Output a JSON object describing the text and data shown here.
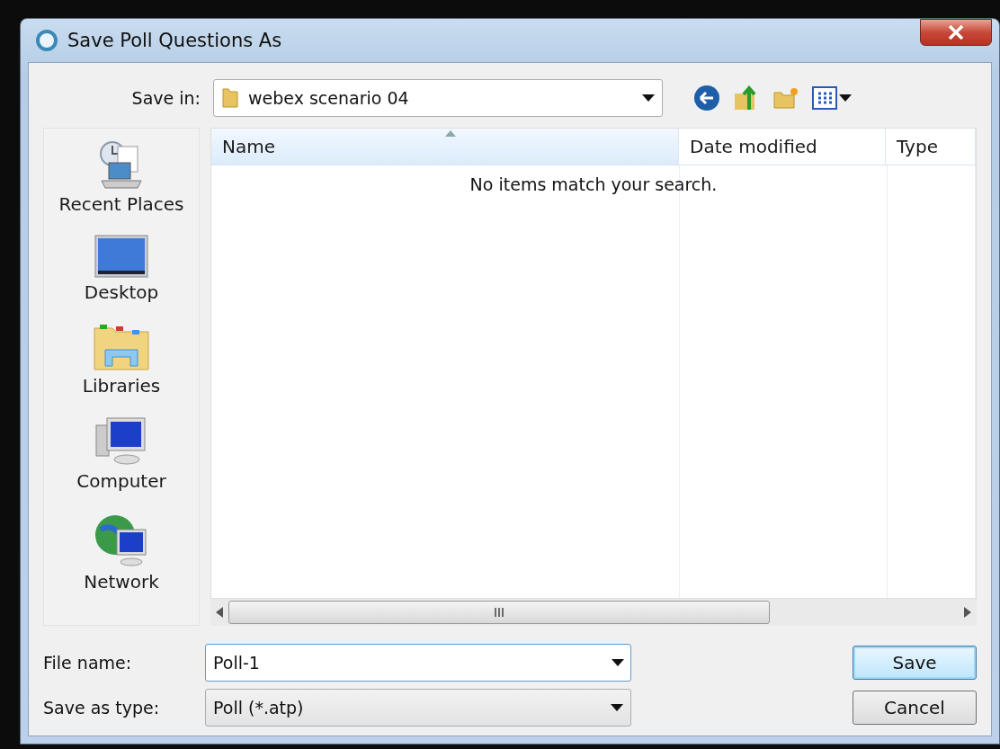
{
  "window": {
    "title": "Save Poll Questions As"
  },
  "toolbar": {
    "save_in_label": "Save in:",
    "location": "webex scenario 04"
  },
  "sidebar": {
    "items": [
      {
        "label": "Recent Places",
        "kind": "recent"
      },
      {
        "label": "Desktop",
        "kind": "desktop"
      },
      {
        "label": "Libraries",
        "kind": "libraries"
      },
      {
        "label": "Computer",
        "kind": "computer"
      },
      {
        "label": "Network",
        "kind": "network"
      }
    ]
  },
  "file_list": {
    "columns": [
      {
        "label": "Name",
        "sorted": true
      },
      {
        "label": "Date modified",
        "sorted": false
      },
      {
        "label": "Type",
        "sorted": false
      }
    ],
    "empty_message": "No items match your search."
  },
  "form": {
    "file_name_label": "File name:",
    "file_name": "Poll-1",
    "type_label": "Save as type:",
    "type": "Poll (*.atp)"
  },
  "buttons": [
    {
      "label": "Save",
      "default": true
    },
    {
      "label": "Cancel",
      "default": false
    }
  ]
}
